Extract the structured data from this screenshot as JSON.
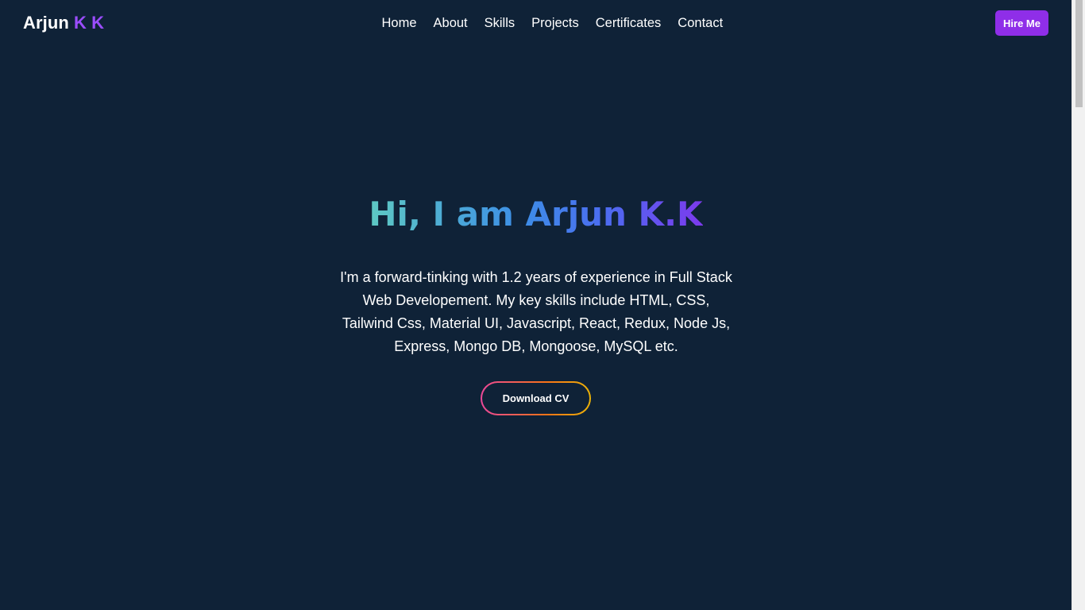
{
  "nav": {
    "logo_name": "Arjun",
    "logo_accent": "K K",
    "links": [
      "Home",
      "About",
      "Skills",
      "Projects",
      "Certificates",
      "Contact"
    ],
    "hire_label": "Hire Me"
  },
  "hero": {
    "title": "Hi, I am Arjun K.K",
    "description": "I'm a forward-tinking with 1.2 years of experience in Full Stack Web Developement. My key skills include HTML, CSS, Tailwind Css, Material UI, Javascript, React, Redux, Node Js, Express, Mongo DB, Mongoose, MySQL etc.",
    "cv_label": "Download CV"
  },
  "colors": {
    "background": "#0f2237",
    "accent": "#8f2ee8",
    "logo_accent": "#9b4dff"
  }
}
